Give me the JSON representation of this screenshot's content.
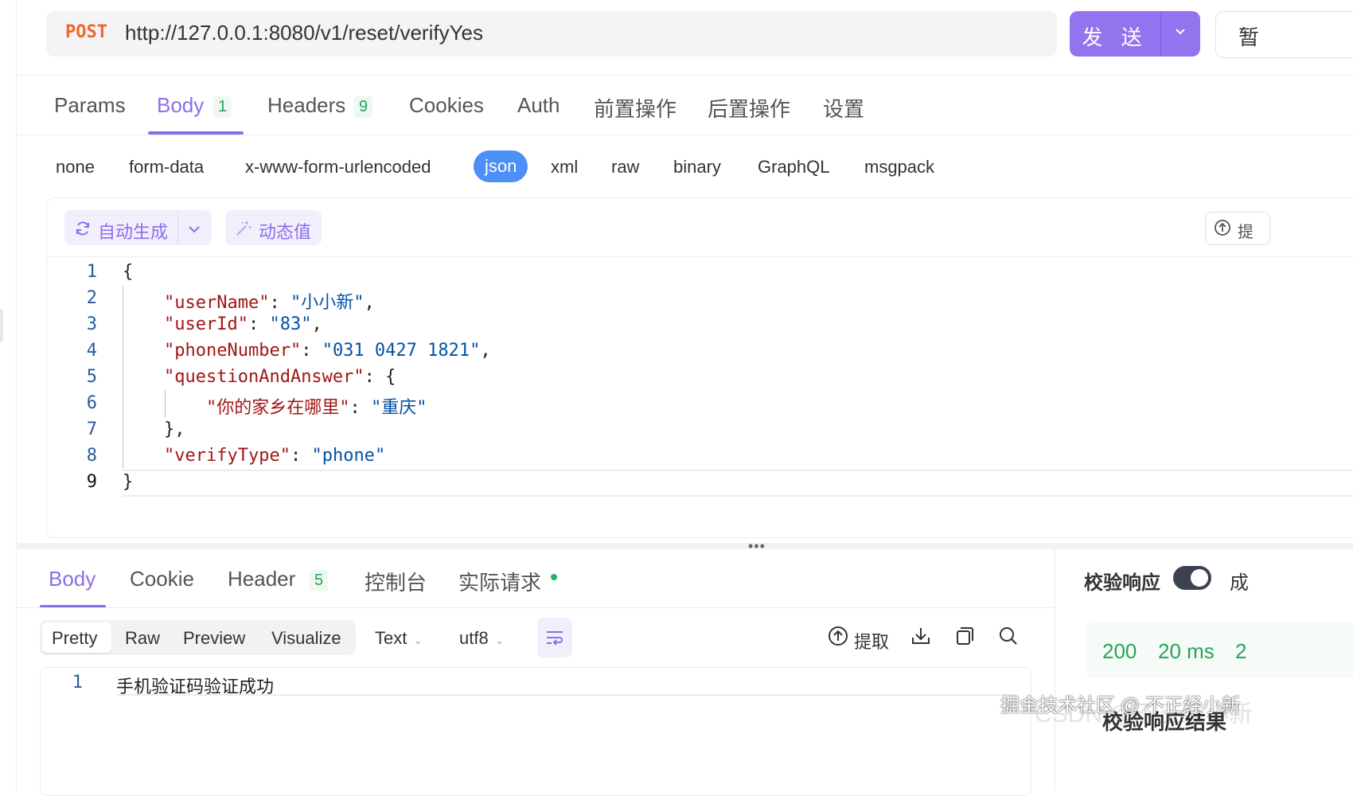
{
  "request": {
    "method": "POST",
    "url": "http://127.0.0.1:8080/v1/reset/verifyYes",
    "send_label": "发 送",
    "save_label": "暂"
  },
  "req_tabs": [
    {
      "label": "Params"
    },
    {
      "label": "Body",
      "badge": "1",
      "active": true
    },
    {
      "label": "Headers",
      "badge": "9"
    },
    {
      "label": "Cookies"
    },
    {
      "label": "Auth"
    },
    {
      "label": "前置操作"
    },
    {
      "label": "后置操作"
    },
    {
      "label": "设置"
    }
  ],
  "body_types": [
    "none",
    "form-data",
    "x-www-form-urlencoded",
    "json",
    "xml",
    "raw",
    "binary",
    "GraphQL",
    "msgpack"
  ],
  "body_type_active": "json",
  "editor": {
    "auto_generate_label": "自动生成",
    "dynamic_value_label": "动态值",
    "extract_partial": "提",
    "line_numbers": [
      "1",
      "2",
      "3",
      "4",
      "5",
      "6",
      "7",
      "8",
      "9"
    ],
    "lines": [
      "{",
      "\"userName\": \"小小新\",",
      "\"userId\": \"83\",",
      "\"phoneNumber\": \"031 0427 1821\",",
      "\"questionAndAnswer\": {",
      "\"你的家乡在哪里\": \"重庆\"",
      "},",
      "\"verifyType\": \"phone\"",
      "}"
    ],
    "json": {
      "userName": "小小新",
      "userId": "83",
      "phoneNumber": "031 0427 1821",
      "questionAndAnswer_key": "questionAndAnswer",
      "question": "你的家乡在哪里",
      "answer": "重庆",
      "verifyType": "phone"
    }
  },
  "resp_tabs": [
    {
      "label": "Body",
      "active": true
    },
    {
      "label": "Cookie"
    },
    {
      "label": "Header",
      "badge": "5"
    },
    {
      "label": "控制台"
    },
    {
      "label": "实际请求",
      "dot": true
    }
  ],
  "resp_toolbar": {
    "views": [
      "Pretty",
      "Raw",
      "Preview",
      "Visualize"
    ],
    "active_view": "Pretty",
    "format": "Text",
    "encoding": "utf8",
    "extract_label": "提取"
  },
  "response": {
    "line_number": "1",
    "text": "手机验证码验证成功"
  },
  "validation": {
    "label": "校验响应",
    "toggle_on": true,
    "right_partial": "成",
    "status": "200",
    "time": "20 ms",
    "size_partial": "2",
    "result_label": "校验响应结果"
  },
  "watermark": "掘金技术社区 @ 不正经小新",
  "watermark2": "CSDN @不正经小新",
  "colors": {
    "accent": "#8b6ee9",
    "send": "#9373ee",
    "method": "#f0672b",
    "success": "#25a55b",
    "json_pill": "#4b8ff7"
  }
}
